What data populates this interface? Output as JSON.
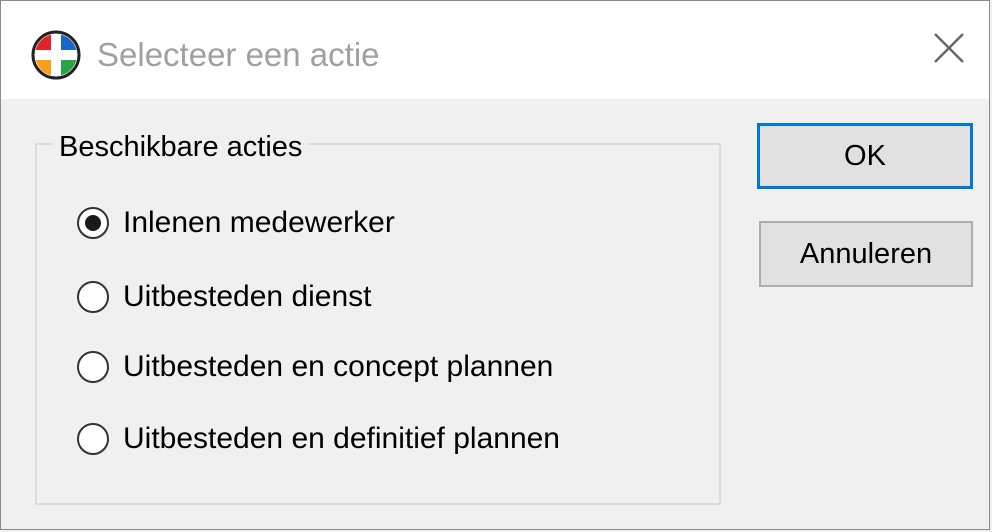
{
  "window": {
    "title": "Selecteer een actie",
    "icon": "app-cross-icon",
    "close_icon": "close-icon"
  },
  "group": {
    "label": "Beschikbare acties",
    "options": [
      {
        "label": "Inlenen medewerker",
        "selected": true
      },
      {
        "label": "Uitbesteden dienst",
        "selected": false
      },
      {
        "label": "Uitbesteden en concept plannen",
        "selected": false
      },
      {
        "label": "Uitbesteden en definitief plannen",
        "selected": false
      }
    ]
  },
  "buttons": {
    "ok_label": "OK",
    "cancel_label": "Annuleren"
  },
  "colors": {
    "focus_border": "#0078d7",
    "title_text": "#a0a0a0",
    "dialog_bg": "#f0f0f0"
  }
}
